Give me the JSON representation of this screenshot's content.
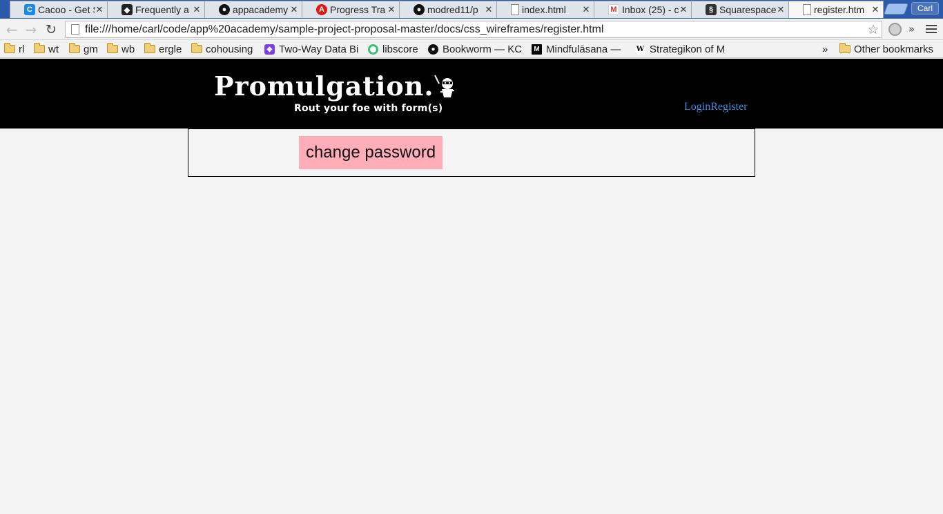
{
  "browser": {
    "tabs": [
      {
        "title": "Cacoo - Get S",
        "icon": "cacoo-icon",
        "color": "#1e88e5"
      },
      {
        "title": "Frequently a",
        "icon": "inkscape-icon",
        "color": "#222222"
      },
      {
        "title": "appacademy",
        "icon": "github-icon",
        "color": "#111111"
      },
      {
        "title": "Progress Tra",
        "icon": "angular-icon",
        "color": "#dd1b16"
      },
      {
        "title": "modred11/p",
        "icon": "github-icon",
        "color": "#111111"
      },
      {
        "title": "index.html",
        "icon": "page-icon",
        "color": "#ffffff"
      },
      {
        "title": "Inbox (25) - c",
        "icon": "gmail-icon",
        "color": "#d93025"
      },
      {
        "title": "Squarespace",
        "icon": "squarespace-icon",
        "color": "#222222"
      },
      {
        "title": "register.htm",
        "icon": "page-icon",
        "color": "#ffffff"
      }
    ],
    "user": "Carl",
    "url": "file:///home/carl/code/app%20academy/sample-project-proposal-master/docs/css_wireframes/register.html",
    "bookmarks": [
      {
        "label": "rl",
        "type": "folder"
      },
      {
        "label": "wt",
        "type": "folder"
      },
      {
        "label": "gm",
        "type": "folder"
      },
      {
        "label": "wb",
        "type": "folder"
      },
      {
        "label": "ergle",
        "type": "folder"
      },
      {
        "label": "cohousing",
        "type": "folder"
      },
      {
        "label": "Two-Way Data Bi",
        "type": "link",
        "icon": "cube-icon",
        "color": "#7b3fe4"
      },
      {
        "label": "libscore",
        "type": "link",
        "icon": "ring-icon",
        "color": "#3ac06e"
      },
      {
        "label": "Bookworm — KC",
        "type": "link",
        "icon": "bookworm-icon",
        "color": "#111111"
      },
      {
        "label": "Mindfulāsana — ",
        "type": "link",
        "icon": "medium-icon",
        "color": "#000000"
      },
      {
        "label": "Strategikon of M",
        "type": "link",
        "icon": "wikipedia-icon",
        "color": "#ffffff"
      }
    ],
    "overflow": "»",
    "other_bookmarks": "Other bookmarks"
  },
  "page": {
    "logo": "Promulgation.",
    "tagline": "Rout your foe with form(s)",
    "login_link": "Login",
    "register_link": "Register",
    "change_password_button": "change password"
  }
}
